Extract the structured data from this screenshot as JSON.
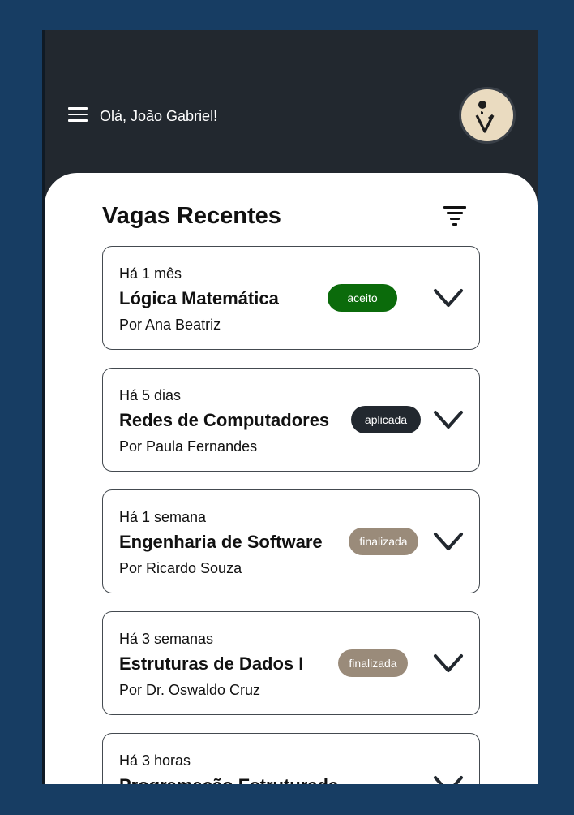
{
  "header": {
    "greeting": "Olá, João Gabriel!"
  },
  "main": {
    "title": "Vagas Recentes",
    "jobs": [
      {
        "time": "Há 1 mês",
        "title": "Lógica Matemática",
        "author": "Por Ana Beatriz",
        "status": "aceito",
        "status_color": "#0b6b0b"
      },
      {
        "time": "Há 5 dias",
        "title": "Redes de Computadores",
        "author": "Por Paula Fernandes",
        "status": "aplicada",
        "status_color": "#22282f"
      },
      {
        "time": "Há 1 semana",
        "title": "Engenharia de Software",
        "author": "Por Ricardo Souza",
        "status": "finalizada",
        "status_color": "#9a8b7a"
      },
      {
        "time": "Há 3 semanas",
        "title": "Estruturas de Dados I",
        "author": "Por Dr. Oswaldo Cruz",
        "status": "finalizada",
        "status_color": "#9a8b7a"
      },
      {
        "time": "Há 3 horas",
        "title": "Programação Estruturada",
        "author": "",
        "status": "",
        "status_color": ""
      }
    ]
  },
  "icons": {
    "menu": "menu-icon",
    "filter": "filter-icon",
    "expand": "chevron-down-icon",
    "avatar": "logo-avatar-icon"
  },
  "colors": {
    "background": "#173d63",
    "header": "#22282f",
    "card_border": "#444a50",
    "avatar_bg": "#eadbc0"
  }
}
